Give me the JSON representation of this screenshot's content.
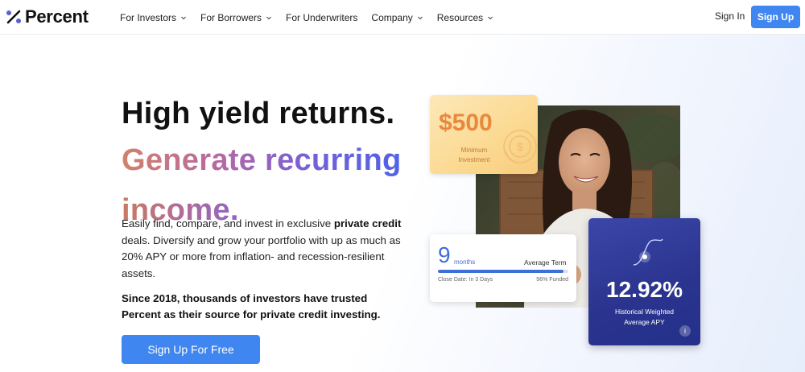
{
  "nav": {
    "logo_text": "Percent",
    "items": [
      {
        "label": "For Investors",
        "dropdown": true
      },
      {
        "label": "For Borrowers",
        "dropdown": true
      },
      {
        "label": "For Underwriters",
        "dropdown": false
      },
      {
        "label": "Company",
        "dropdown": true
      },
      {
        "label": "Resources",
        "dropdown": true
      }
    ],
    "signin_label": "Sign In",
    "signup_label": "Sign Up"
  },
  "hero": {
    "headline": "High yield returns.",
    "sub_line1": "Generate recurring",
    "sub_line2": "income.",
    "para_prefix": "Easily find, compare, and invest in exclusive ",
    "para_bold": "private credit",
    "para_suffix": " deals. Diversify and grow your portfolio with up as much as 20% APY or more from inflation- and recession-resilient assets.",
    "since_text": "Since 2018, thousands of investors have trusted Percent as their source for private credit investing.",
    "cta_label": "Sign Up For Free"
  },
  "cards": {
    "minimum": {
      "amount": "$500",
      "label": "Minimum Investment"
    },
    "term": {
      "number": "9",
      "unit": "months",
      "title": "Average Term",
      "close_text": "Close Date: In 3 Days",
      "funded_text": "96% Funded",
      "funded_fraction": 0.96
    },
    "apy": {
      "value": "12.92%",
      "label_line1": "Historical Weighted",
      "label_line2": "Average APY",
      "info": "i"
    }
  },
  "colors": {
    "accent": "#3f86f0",
    "logo_purple": "#5b5fd6",
    "apy_card": "#2a348e",
    "min_card": "#fbd991",
    "term_blue": "#3f6ed8"
  }
}
